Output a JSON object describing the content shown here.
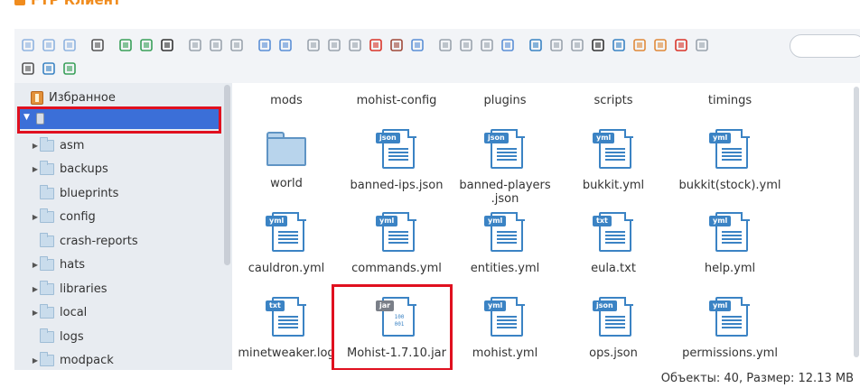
{
  "window": {
    "title": "FTP Клиент"
  },
  "toolbar": {
    "row1": [
      "back-icon",
      "forward-icon",
      "up-icon",
      "computer-icon",
      "new-file-icon",
      "add-file-icon",
      "save-icon",
      "copy-doc-icon",
      "save-as-icon",
      "select-icon",
      "undo-icon",
      "redo-icon",
      "duplicate-icon",
      "cut-icon",
      "paste-icon",
      "delete-icon",
      "archive-icon",
      "extract-icon",
      "copy-icon",
      "grid-select-icon",
      "edit-icon",
      "share-icon",
      "large-icons-icon",
      "small-icons-icon",
      "list-view-icon",
      "preview-icon",
      "info-icon",
      "tree-up-icon",
      "tree-add-icon",
      "details-view-icon",
      "rename-icon"
    ],
    "row2": [
      "settings-icon",
      "help-icon",
      "fullscreen-icon"
    ],
    "search": {
      "placeholder": ""
    }
  },
  "sidebar": {
    "favorites": "Избранное",
    "root": "",
    "items": [
      {
        "label": "asm",
        "expandable": true
      },
      {
        "label": "backups",
        "expandable": true
      },
      {
        "label": "blueprints",
        "expandable": false
      },
      {
        "label": "config",
        "expandable": true
      },
      {
        "label": "crash-reports",
        "expandable": false
      },
      {
        "label": "hats",
        "expandable": true
      },
      {
        "label": "libraries",
        "expandable": true
      },
      {
        "label": "local",
        "expandable": true
      },
      {
        "label": "logs",
        "expandable": false
      },
      {
        "label": "modpack",
        "expandable": true
      }
    ]
  },
  "files": [
    {
      "name": "mods",
      "type": "folder-partial"
    },
    {
      "name": "mohist-config",
      "type": "folder-partial"
    },
    {
      "name": "plugins",
      "type": "folder-partial"
    },
    {
      "name": "scripts",
      "type": "folder-partial"
    },
    {
      "name": "timings",
      "type": "folder-partial"
    },
    {
      "name": "world",
      "type": "folder"
    },
    {
      "name": "banned-ips.json",
      "type": "json"
    },
    {
      "name": "banned-players\n.json",
      "type": "json"
    },
    {
      "name": "bukkit.yml",
      "type": "yml"
    },
    {
      "name": "bukkit(stock).yml",
      "type": "yml"
    },
    {
      "name": "cauldron.yml",
      "type": "yml"
    },
    {
      "name": "commands.yml",
      "type": "yml"
    },
    {
      "name": "entities.yml",
      "type": "yml"
    },
    {
      "name": "eula.txt",
      "type": "txt"
    },
    {
      "name": "help.yml",
      "type": "yml"
    },
    {
      "name": "minetweaker.log",
      "type": "txt"
    },
    {
      "name": "Mohist-1.7.10.jar",
      "type": "jar"
    },
    {
      "name": "mohist.yml",
      "type": "yml"
    },
    {
      "name": "ops.json",
      "type": "json"
    },
    {
      "name": "permissions.yml",
      "type": "yml"
    }
  ],
  "jar_icon_text": "100\n001",
  "status": {
    "text": "Объекты: 40, Размер: 12.13 MB"
  },
  "colors": {
    "accent": "#3b6fd8",
    "highlight": "#e0101f",
    "icon": "#3b83c4",
    "title": "#f08c1e"
  }
}
